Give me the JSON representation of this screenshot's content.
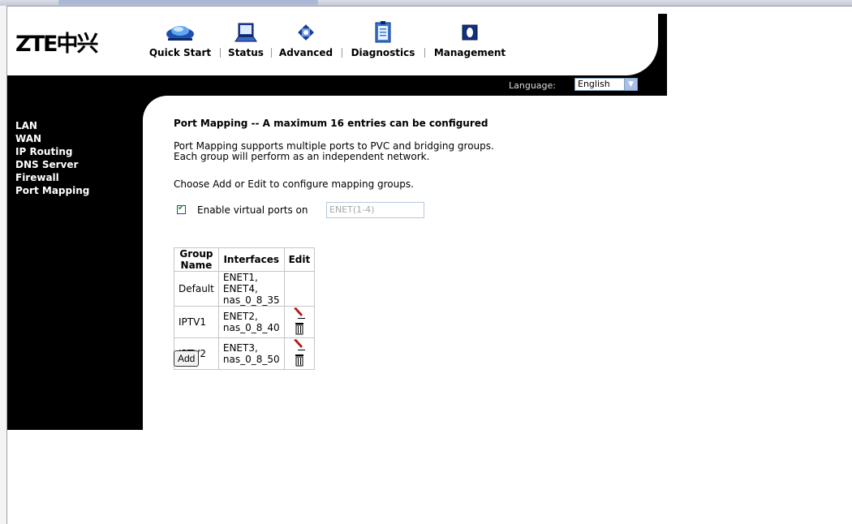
{
  "app": {
    "logo_text": "ZTE中兴"
  },
  "nav": {
    "items": [
      {
        "label": "Quick Start",
        "icon": "car-icon"
      },
      {
        "label": "Status",
        "icon": "laptop-icon"
      },
      {
        "label": "Advanced",
        "icon": "chip-icon"
      },
      {
        "label": "Diagnostics",
        "icon": "clipboard-icon"
      },
      {
        "label": "Management",
        "icon": "management-icon"
      }
    ]
  },
  "language": {
    "label": "Language:",
    "selected": "English"
  },
  "sidebar": {
    "items": [
      {
        "label": "LAN"
      },
      {
        "label": "WAN"
      },
      {
        "label": "IP Routing"
      },
      {
        "label": "DNS Server"
      },
      {
        "label": "Firewall"
      },
      {
        "label": "Port Mapping"
      }
    ]
  },
  "main": {
    "title": "Port Mapping -- A maximum 16 entries can be configured",
    "desc_line1": "Port Mapping supports multiple ports to PVC and bridging groups.",
    "desc_line2": "Each group will perform as an independent network.",
    "choose_text": "Choose Add or Edit to configure mapping groups.",
    "virtual_ports": {
      "checked": true,
      "label": "Enable virtual ports on",
      "value": "ENET(1-4)"
    },
    "table": {
      "headers": [
        "Group Name",
        "Interfaces",
        "Edit"
      ],
      "rows": [
        {
          "group": "Default",
          "interfaces": "ENET1, ENET4, nas_0_8_35",
          "editable": false
        },
        {
          "group": "IPTV1",
          "interfaces": "ENET2, nas_0_8_40",
          "editable": true
        },
        {
          "group": "IPTV2",
          "interfaces": "ENET3, nas_0_8_50",
          "editable": true
        }
      ]
    },
    "add_label": "Add"
  }
}
